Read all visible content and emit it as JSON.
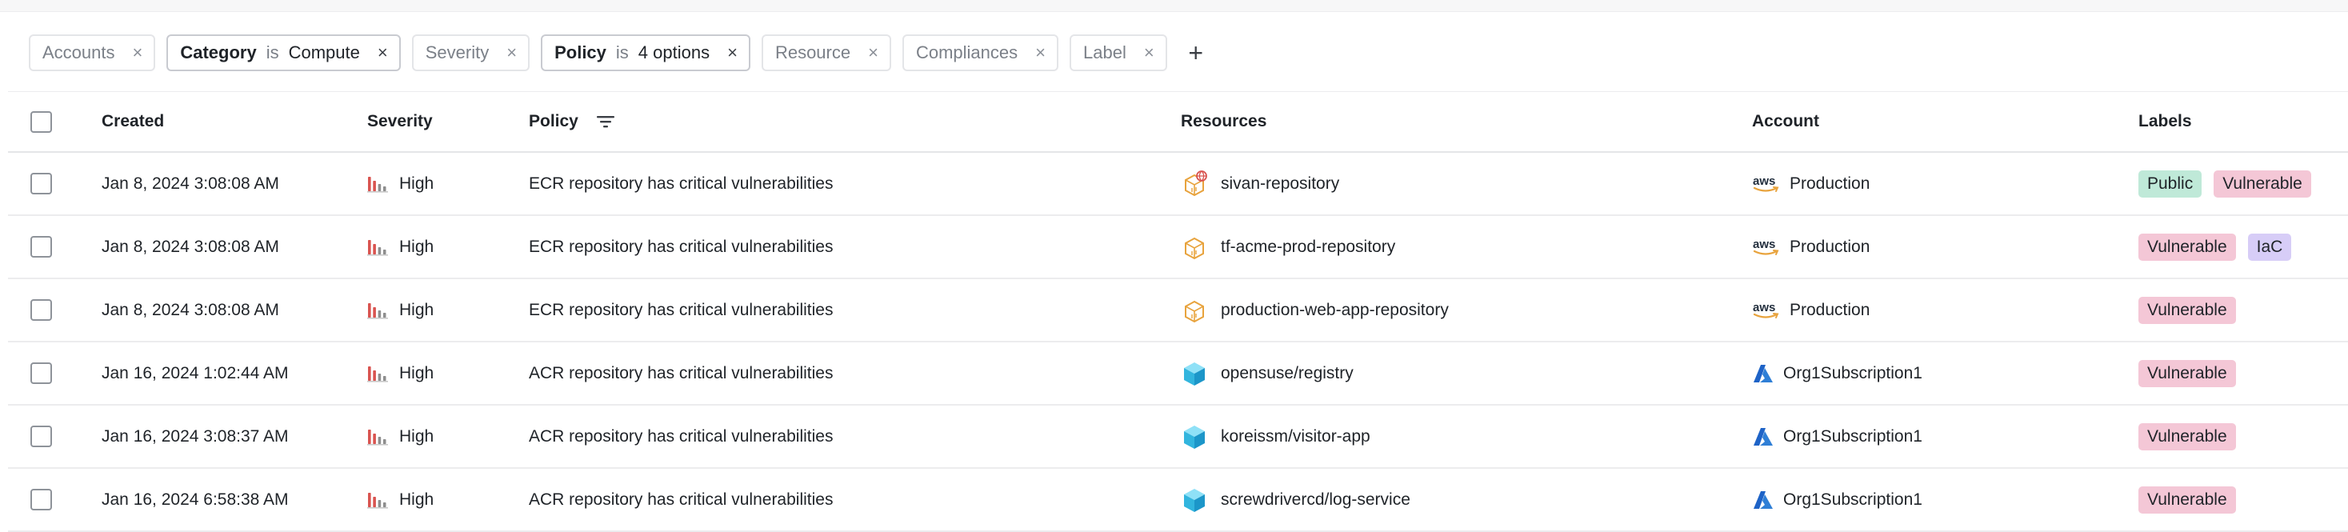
{
  "filters": [
    {
      "key": "Accounts",
      "active": false
    },
    {
      "key": "Category",
      "op": "is",
      "value": "Compute",
      "active": true
    },
    {
      "key": "Severity",
      "active": false
    },
    {
      "key": "Policy",
      "op": "is",
      "value": "4 options",
      "active": true
    },
    {
      "key": "Resource",
      "active": false
    },
    {
      "key": "Compliances",
      "active": false
    },
    {
      "key": "Label",
      "active": false
    }
  ],
  "filter_add_label": "+",
  "chip_remove_glyph": "×",
  "columns": {
    "created": "Created",
    "severity": "Severity",
    "policy": "Policy",
    "resources": "Resources",
    "account": "Account",
    "labels": "Labels"
  },
  "colors": {
    "severity_high_bar": "#d9534f",
    "severity_muted_bar": "#8e8e8e",
    "aws_orange": "#e8a33d",
    "azure_blue": "#2f7fd6",
    "azure_cube": "#3fc3e8",
    "label_public": "#bfe9d8",
    "label_vulnerable": "#f4c7d6",
    "label_iac": "#d7cdf7"
  },
  "rows": [
    {
      "created": "Jan 8, 2024 3:08:08 AM",
      "severity": "High",
      "policy": "ECR repository has critical vulnerabilities",
      "resource": "sivan-repository",
      "resource_icon": "ecr-repository-public-icon",
      "account_icon": "aws-logo-icon",
      "account_logo_text": "aws",
      "account": "Production",
      "labels": [
        {
          "text": "Public",
          "color": "green"
        },
        {
          "text": "Vulnerable",
          "color": "pink"
        }
      ]
    },
    {
      "created": "Jan 8, 2024 3:08:08 AM",
      "severity": "High",
      "policy": "ECR repository has critical vulnerabilities",
      "resource": "tf-acme-prod-repository",
      "resource_icon": "ecr-repository-icon",
      "account_icon": "aws-logo-icon",
      "account_logo_text": "aws",
      "account": "Production",
      "labels": [
        {
          "text": "Vulnerable",
          "color": "pink"
        },
        {
          "text": "IaC",
          "color": "purple"
        }
      ]
    },
    {
      "created": "Jan 8, 2024 3:08:08 AM",
      "severity": "High",
      "policy": "ECR repository has critical vulnerabilities",
      "resource": "production-web-app-repository",
      "resource_icon": "ecr-repository-icon",
      "account_icon": "aws-logo-icon",
      "account_logo_text": "aws",
      "account": "Production",
      "labels": [
        {
          "text": "Vulnerable",
          "color": "pink"
        }
      ]
    },
    {
      "created": "Jan 16, 2024 1:02:44 AM",
      "severity": "High",
      "policy": "ACR repository has critical vulnerabilities",
      "resource": "opensuse/registry",
      "resource_icon": "acr-registry-icon",
      "account_icon": "azure-logo-icon",
      "account": "Org1Subscription1",
      "labels": [
        {
          "text": "Vulnerable",
          "color": "pink"
        }
      ]
    },
    {
      "created": "Jan 16, 2024 3:08:37 AM",
      "severity": "High",
      "policy": "ACR repository has critical vulnerabilities",
      "resource": "koreissm/visitor-app",
      "resource_icon": "acr-registry-icon",
      "account_icon": "azure-logo-icon",
      "account": "Org1Subscription1",
      "labels": [
        {
          "text": "Vulnerable",
          "color": "pink"
        }
      ]
    },
    {
      "created": "Jan 16, 2024 6:58:38 AM",
      "severity": "High",
      "policy": "ACR repository has critical vulnerabilities",
      "resource": "screwdrivercd/log-service",
      "resource_icon": "acr-registry-icon",
      "account_icon": "azure-logo-icon",
      "account": "Org1Subscription1",
      "labels": [
        {
          "text": "Vulnerable",
          "color": "pink"
        }
      ]
    }
  ]
}
